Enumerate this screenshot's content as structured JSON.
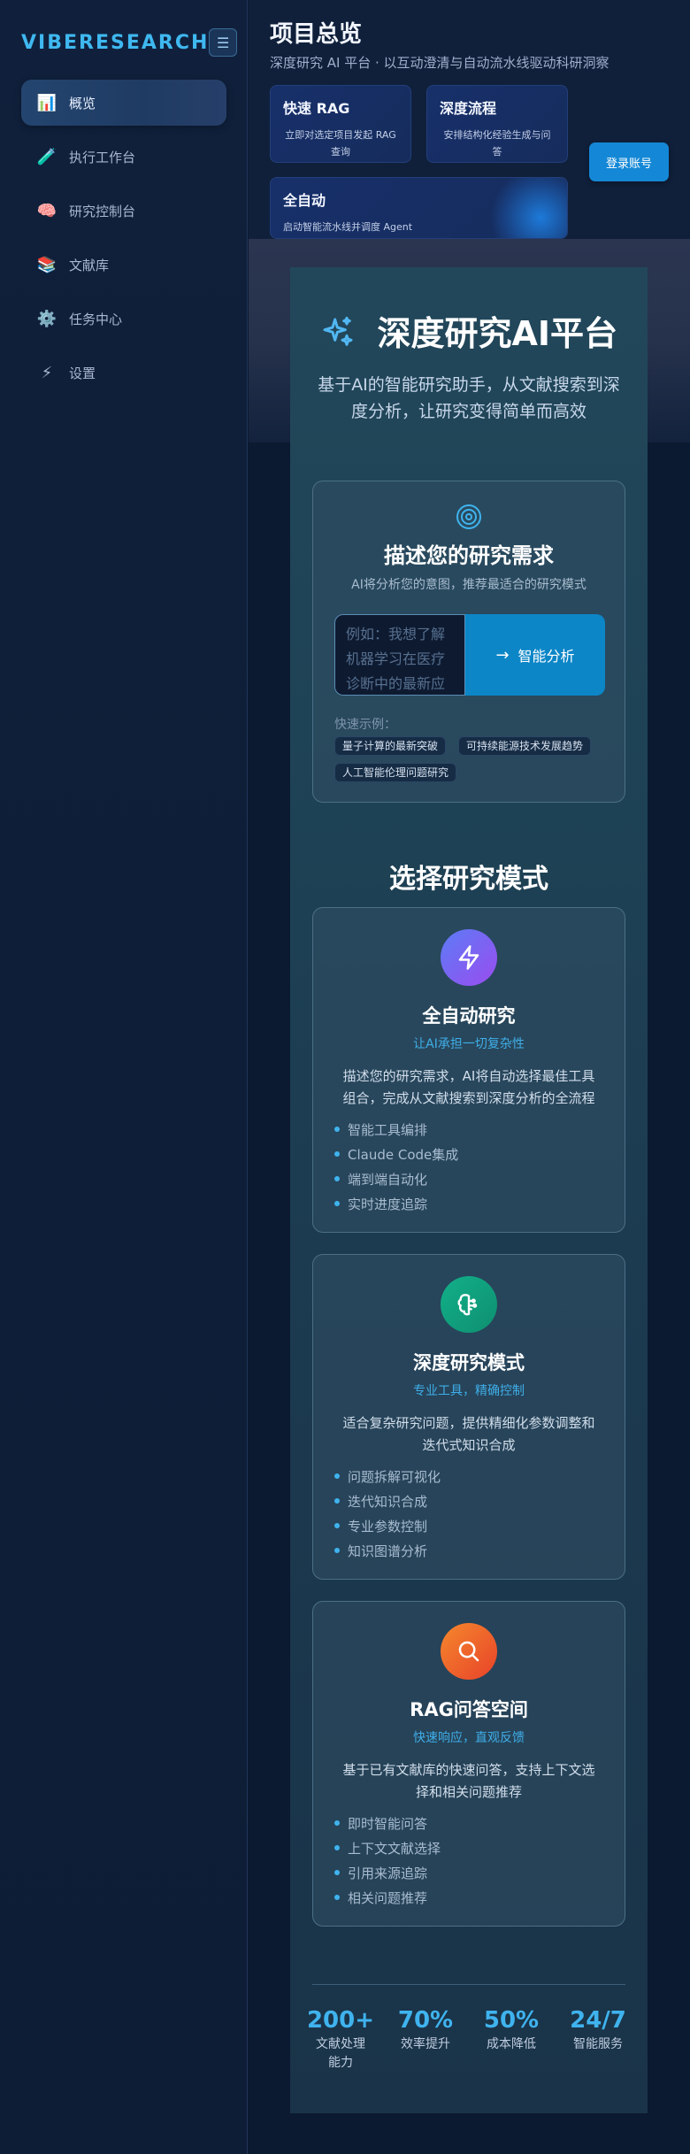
{
  "sidebar": {
    "brand": "VIBERESEARCH",
    "items": [
      {
        "icon": "📊",
        "label": "概览"
      },
      {
        "icon": "🧪",
        "label": "执行工作台"
      },
      {
        "icon": "🧠",
        "label": "研究控制台"
      },
      {
        "icon": "📚",
        "label": "文献库"
      },
      {
        "icon": "⚙️",
        "label": "任务中心"
      },
      {
        "icon": "⚡",
        "label": "设置"
      }
    ]
  },
  "header": {
    "title": "项目总览",
    "subtitle": "深度研究 AI 平台 · 以互动澄清与自动流水线驱动科研洞察",
    "login_label": "登录账号",
    "quick_cards": [
      {
        "title": "快速 RAG",
        "desc": "立即对选定项目发起 RAG 查询"
      },
      {
        "title": "深度流程",
        "desc": "安排结构化经验生成与问答"
      },
      {
        "title": "全自动",
        "desc": "启动智能流水线并调度 Agent"
      }
    ]
  },
  "hero": {
    "title": "深度研究AI平台",
    "description": "基于AI的智能研究助手，从文献搜索到深度分析，让研究变得简单而高效"
  },
  "request": {
    "title": "描述您的研究需求",
    "subtitle": "AI将分析您的意图，推荐最适合的研究模式",
    "placeholder": "例如：我想了解机器学习在医疗诊断中的最新应用",
    "analyze_label": "智能分析",
    "quick_label": "快速示例：",
    "examples": [
      "量子计算的最新突破",
      "可持续能源技术发展趋势",
      "人工智能伦理问题研究"
    ]
  },
  "modes": {
    "title": "选择研究模式",
    "items": [
      {
        "title": "全自动研究",
        "tagline": "让AI承担一切复杂性",
        "desc": "描述您的研究需求，AI将自动选择最佳工具组合，完成从文献搜索到深度分析的全流程",
        "features": [
          "智能工具编排",
          "Claude Code集成",
          "端到端自动化",
          "实时进度追踪"
        ],
        "icon": "lightning-icon",
        "color": "#7c5cf0"
      },
      {
        "title": "深度研究模式",
        "tagline": "专业工具，精确控制",
        "desc": "适合复杂研究问题，提供精细化参数调整和迭代式知识合成",
        "features": [
          "问题拆解可视化",
          "迭代知识合成",
          "专业参数控制",
          "知识图谱分析"
        ],
        "icon": "brain-icon",
        "color": "#14a57e"
      },
      {
        "title": "RAG问答空间",
        "tagline": "快速响应，直观反馈",
        "desc": "基于已有文献库的快速问答，支持上下文选择和相关问题推荐",
        "features": [
          "即时智能问答",
          "上下文文献选择",
          "引用来源追踪",
          "相关问题推荐"
        ],
        "icon": "search-icon",
        "color": "#f0602a"
      }
    ]
  },
  "stats": [
    {
      "value": "200+",
      "label": "文献处理能力"
    },
    {
      "value": "70%",
      "label": "效率提升"
    },
    {
      "value": "50%",
      "label": "成本降低"
    },
    {
      "value": "24/7",
      "label": "智能服务"
    }
  ]
}
